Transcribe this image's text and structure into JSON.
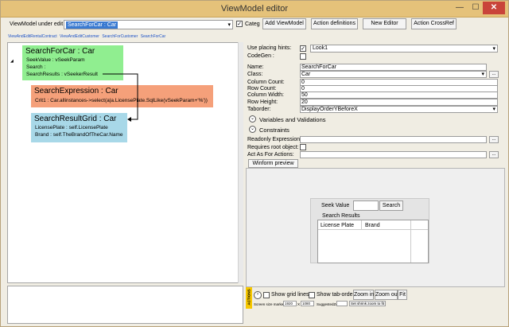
{
  "window": {
    "title": "ViewModel editor",
    "min": "—",
    "max": "☐",
    "close": "✕"
  },
  "toolbar": {
    "vm_label": "ViewModel under edit",
    "vm_value": "SearchForCar : Car",
    "categ_label": "Categ",
    "categ_checked": "✓",
    "add_viewmodel": "Add ViewModel",
    "action_definitions": "Action definitions",
    "new_editor": "New Editor",
    "action_crossref": "Action CrossRef"
  },
  "breadcrumb": [
    "ViewAndEditRentalContract",
    "ViewAndEditCustomer",
    "SearchForCustomer",
    "SearchForCar"
  ],
  "tree": {
    "expander": "◢",
    "search_for_car": {
      "header": "SearchForCar : Car",
      "rows": [
        "SeekValue : vSeekParam",
        "Search :",
        "SearchResults : vSeekerResult"
      ],
      "color": "#90ee90"
    },
    "search_expression": {
      "header": "SearchExpression : Car",
      "rows": [
        "Crit1 : Car.allinstances->select(a|a.LicensePlate.SqlLike(vSeekParam+'%'))"
      ],
      "color": "#f5a07a"
    },
    "search_result_grid": {
      "header": "SearchResultGrid : Car",
      "rows": [
        "LicensePlate : self.LicensePlate",
        "Brand : self.TheBrandOfTheCar.Name"
      ],
      "color": "#a8d8e8"
    }
  },
  "props": {
    "placing_label": "Use placing hints:",
    "placing_checked": "✓",
    "placing_value": "Look1",
    "codegen_label": "CodeGen :",
    "name_label": "Name:",
    "name_value": "SearchForCar",
    "class_label": "Class:",
    "class_value": "Car",
    "colcount_label": "Column Count:",
    "colcount_value": "0",
    "rowcount_label": "Row Count:",
    "rowcount_value": "0",
    "colwidth_label": "Column Width:",
    "colwidth_value": "50",
    "rowheight_label": "Row Height:",
    "rowheight_value": "20",
    "taborder_label": "Taborder:",
    "taborder_value": "DisplayOrderYBeforeX",
    "variables_label": "Variables and Validations",
    "constraints_label": "Constraints",
    "readonly_label": "Readonly Expression:",
    "rootobj_label": "Requires root object:",
    "actasfor_label": "Act As For Actions:",
    "ellipsis": "...",
    "expand_glyph": "⌄",
    "arrow": "▾"
  },
  "preview": {
    "tab": "Winform preview",
    "seek_label": "Seek Value",
    "search_button": "Search",
    "results_label": "Search Results",
    "columns": [
      "License Plate",
      "Brand"
    ]
  },
  "bottom": {
    "actions": "ACTIONS",
    "nav": "›",
    "show_grid": "Show grid lines",
    "show_tab": "Show tab-order",
    "zoom_in": "Zoom in",
    "zoom_out": "Zoom out",
    "fit": "Fit",
    "screen_label": "Screen size marker:",
    "w": "1920",
    "x": "X",
    "h": "1080",
    "suggested": "SuggestedZoom",
    "shrink": "Set shrink zoom to fit"
  }
}
